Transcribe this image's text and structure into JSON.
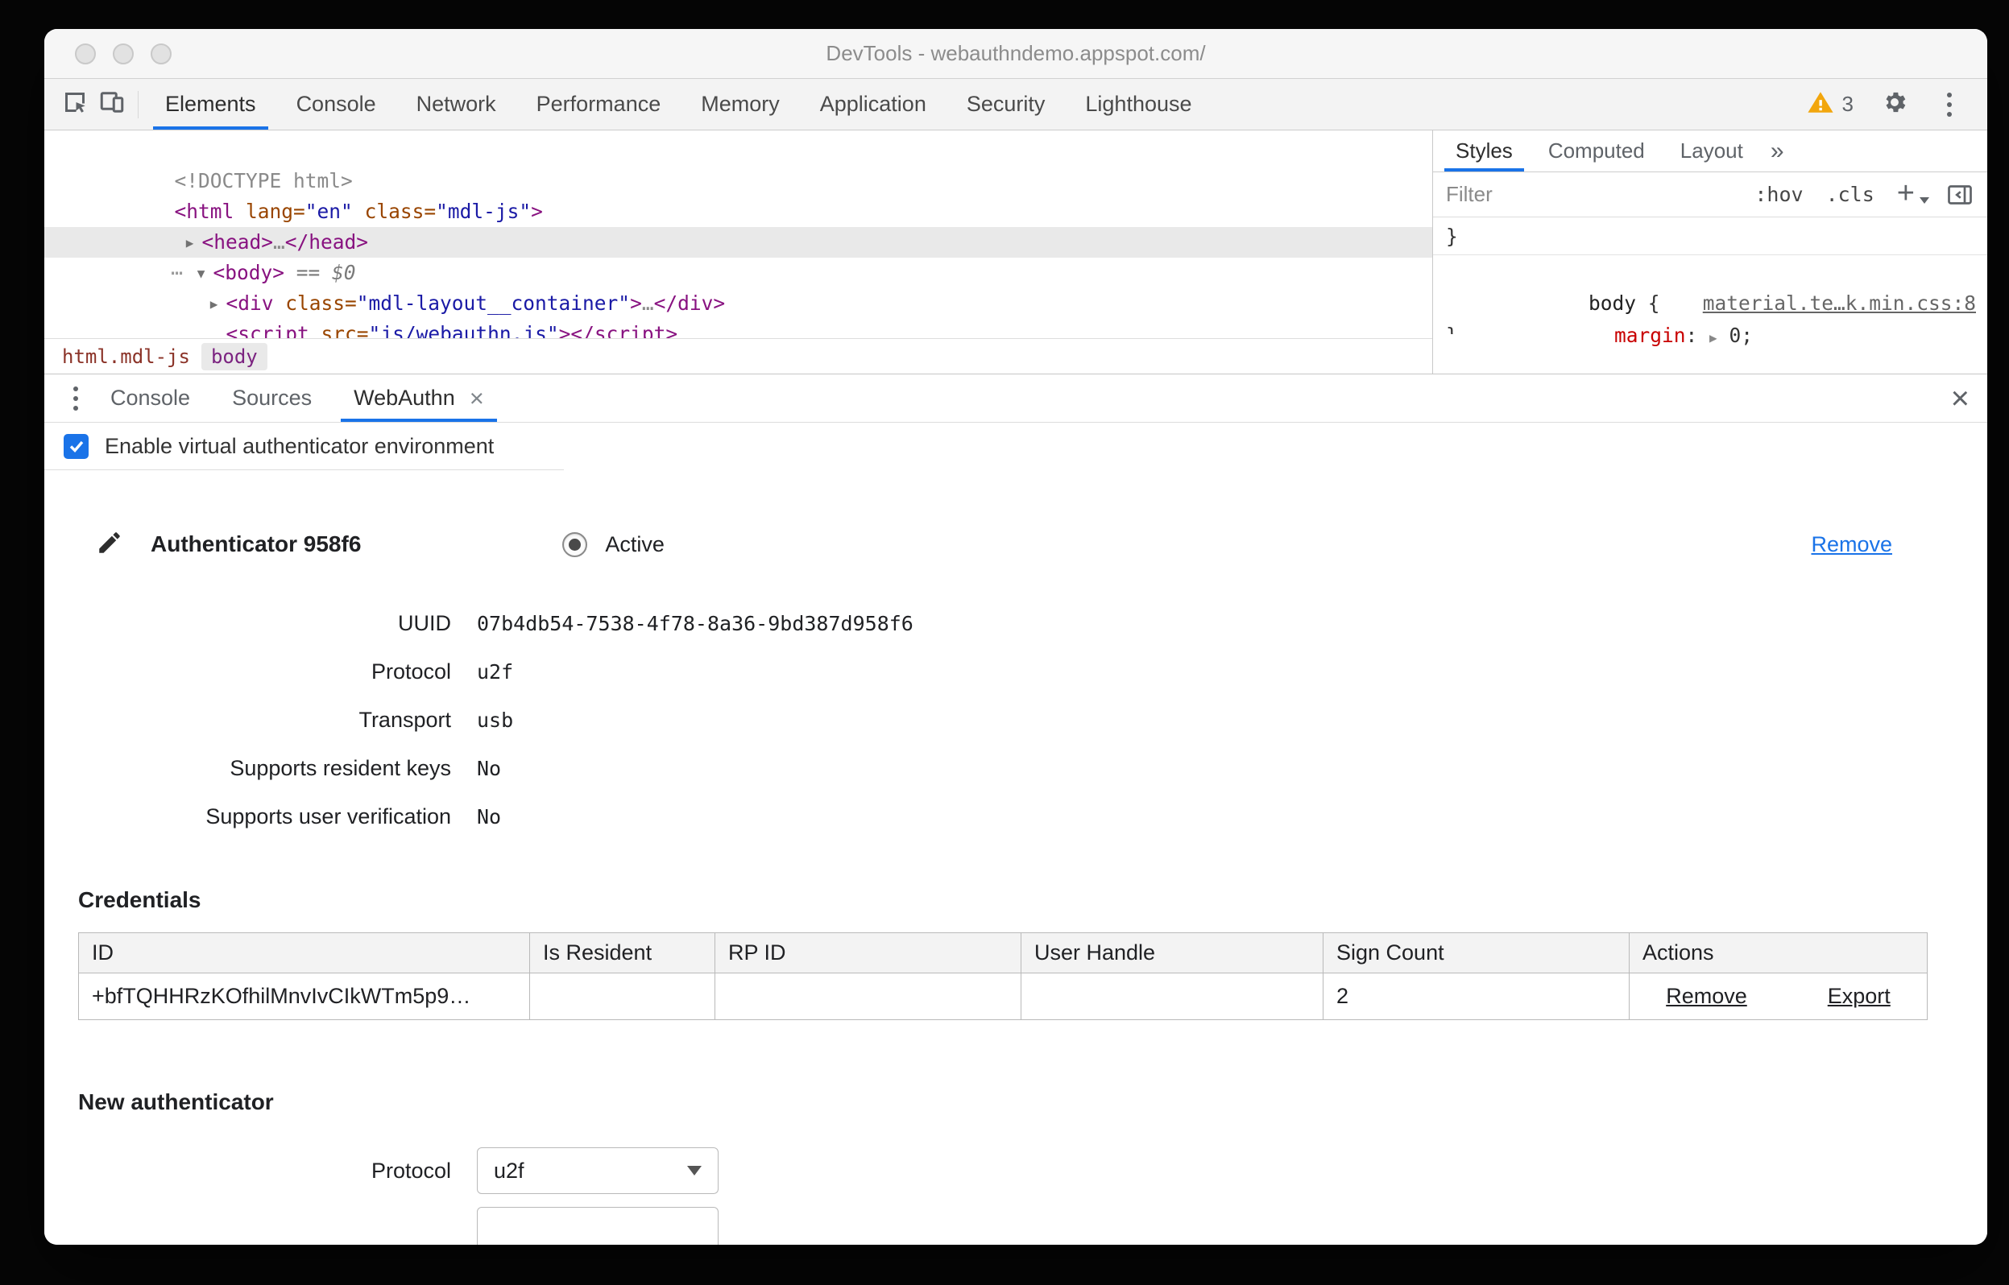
{
  "colors": {
    "accent": "#1a73e8",
    "warning": "#f2a60d"
  },
  "titlebar": {
    "title": "DevTools - webauthndemo.appspot.com/"
  },
  "toolbar": {
    "tabs": [
      {
        "label": "Elements"
      },
      {
        "label": "Console"
      },
      {
        "label": "Network"
      },
      {
        "label": "Performance"
      },
      {
        "label": "Memory"
      },
      {
        "label": "Application"
      },
      {
        "label": "Security"
      },
      {
        "label": "Lighthouse"
      }
    ],
    "warning_count": "3"
  },
  "elements": {
    "code": {
      "doctype": "<!DOCTYPE html>",
      "gt": ">",
      "ellipsis": "…",
      "arrow_right": "▶",
      "arrow_down": "▼",
      "guide_dots": "⋯",
      "html_open": "<html",
      "attr_lang": " lang=",
      "val_en": "\"en\"",
      "attr_class": " class=",
      "val_mdljs": "\"mdl-js\"",
      "head_open": "<head>",
      "head_close": "</head>",
      "body_open": "<body>",
      "flag_eq": " == ",
      "flag_dollar": "$0",
      "div_open": "<div",
      "val_container": "\"mdl-layout__container\"",
      "div_close": "</div>",
      "script_open": "<script",
      "attr_src": " src=",
      "quote": "\"",
      "script_link": "js/webauthn.js",
      "script_close": "</script>"
    },
    "breadcrumbs": {
      "first": "html.mdl-js",
      "second": "body"
    }
  },
  "styles": {
    "tabs": [
      {
        "label": "Styles"
      },
      {
        "label": "Computed"
      },
      {
        "label": "Layout"
      }
    ],
    "more": "»",
    "filter_placeholder": "Filter",
    "pseudo_hover": ":hov",
    "pseudo_class": ".cls",
    "plus": "+",
    "stray_brace": "}",
    "rule": {
      "selector": "body",
      "brace_open": " {",
      "source": "material.te…k.min.css:8",
      "property": "margin",
      "colon": ": ",
      "expand_arrow": "▶",
      "value": " 0;",
      "brace_close": "}"
    }
  },
  "drawer": {
    "tabs": {
      "console": "Console",
      "sources": "Sources",
      "webauthn": "WebAuthn"
    },
    "tab_close": "×",
    "panel_close": "×",
    "checkbox_label": "Enable virtual authenticator environment",
    "authenticator": {
      "title": "Authenticator 958f6",
      "active_label": "Active",
      "remove_label": "Remove",
      "fields": [
        {
          "label": "UUID",
          "value": "07b4db54-7538-4f78-8a36-9bd387d958f6"
        },
        {
          "label": "Protocol",
          "value": "u2f"
        },
        {
          "label": "Transport",
          "value": "usb"
        },
        {
          "label": "Supports resident keys",
          "value": "No"
        },
        {
          "label": "Supports user verification",
          "value": "No"
        }
      ]
    },
    "credentials": {
      "title": "Credentials",
      "headers": [
        "ID",
        "Is Resident",
        "RP ID",
        "User Handle",
        "Sign Count",
        "Actions"
      ],
      "row": {
        "id": "+bfTQHHRzKOfhilMnvIvCIkWTm5p9…",
        "is_resident": "",
        "rp_id": "",
        "user_handle": "",
        "sign_count": "2",
        "remove_label": "Remove",
        "export_label": "Export"
      }
    },
    "new_authenticator": {
      "title": "New authenticator",
      "protocol_label": "Protocol",
      "protocol_value": "u2f"
    }
  }
}
